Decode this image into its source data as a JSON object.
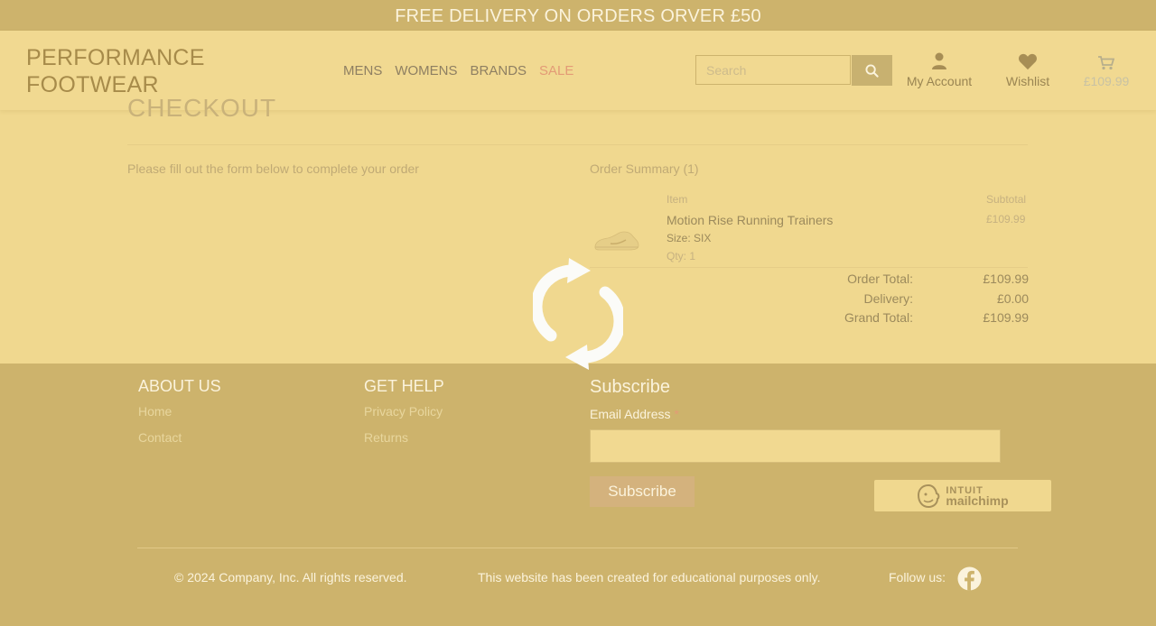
{
  "banner": {
    "text": "FREE DELIVERY ON ORDERS ORVER £50"
  },
  "header": {
    "logo_line1": "PERFORMANCE",
    "logo_line2": "FOOTWEAR",
    "nav": [
      {
        "label": "MENS"
      },
      {
        "label": "WOMENS"
      },
      {
        "label": "BRANDS"
      },
      {
        "label": "SALE"
      }
    ],
    "search_placeholder": "Search",
    "account_label": "My Account",
    "wishlist_label": "Wishlist",
    "cart_total": "£109.99"
  },
  "checkout": {
    "title": "CHECKOUT",
    "form_note": "Please fill out the form below to complete your order",
    "summary_title": "Order Summary (1)",
    "col_item": "Item",
    "col_subtotal": "Subtotal",
    "item": {
      "name": "Motion Rise Running Trainers",
      "size": "Size: SIX",
      "qty": "Qty: 1",
      "subtotal": "£109.99"
    },
    "order_total_label": "Order Total:",
    "order_total": "£109.99",
    "delivery_label": "Delivery:",
    "delivery": "£0.00",
    "grand_total_label": "Grand Total:",
    "grand_total": "£109.99"
  },
  "footer": {
    "about_heading": "ABOUT US",
    "about_links": [
      "Home",
      "Contact"
    ],
    "help_heading": "GET HELP",
    "help_links": [
      "Privacy Policy",
      "Returns"
    ],
    "subscribe_heading": "Subscribe",
    "email_label": "Email Address",
    "required_mark": "*",
    "subscribe_button": "Subscribe",
    "mailchimp_line1": "INTUIT",
    "mailchimp_line2": "mailchimp",
    "copyright": "© 2024 Company, Inc. All rights reserved.",
    "educational": "This website has been created for educational purposes only.",
    "follow": "Follow us:"
  },
  "colors": {
    "overlay": "#f0d88f",
    "footer": "#cdb36c",
    "sale": "#e39b76"
  },
  "icons": {
    "search": "search-icon",
    "account": "user-icon",
    "wishlist": "heart-icon",
    "cart": "cart-icon",
    "loader": "refresh-icon",
    "social": "facebook-icon"
  }
}
